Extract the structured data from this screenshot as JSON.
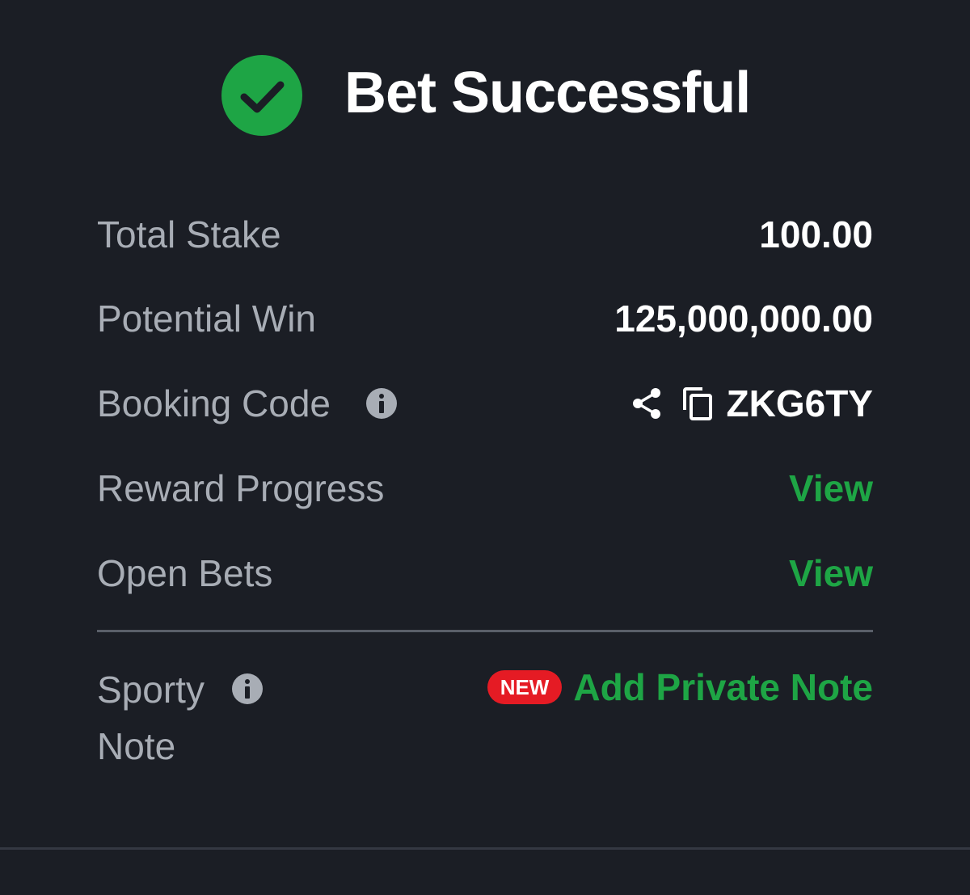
{
  "header": {
    "title": "Bet Successful",
    "icon": "check-circle-icon",
    "icon_color": "#1ea545"
  },
  "rows": {
    "total_stake": {
      "label": "Total Stake",
      "value": "100.00"
    },
    "potential_win": {
      "label": "Potential Win",
      "value": "125,000,000.00"
    },
    "booking_code": {
      "label": "Booking Code",
      "value": "ZKG6TY"
    },
    "reward_progress": {
      "label": "Reward Progress",
      "value": "View"
    },
    "open_bets": {
      "label": "Open Bets",
      "value": "View"
    }
  },
  "note": {
    "label_line1": "Sporty",
    "label_line2": "Note",
    "badge": "NEW",
    "action": "Add Private Note"
  },
  "colors": {
    "background": "#1b1e25",
    "accent_green": "#1ea545",
    "badge_red": "#e51b24",
    "label_gray": "#a8adb5"
  }
}
